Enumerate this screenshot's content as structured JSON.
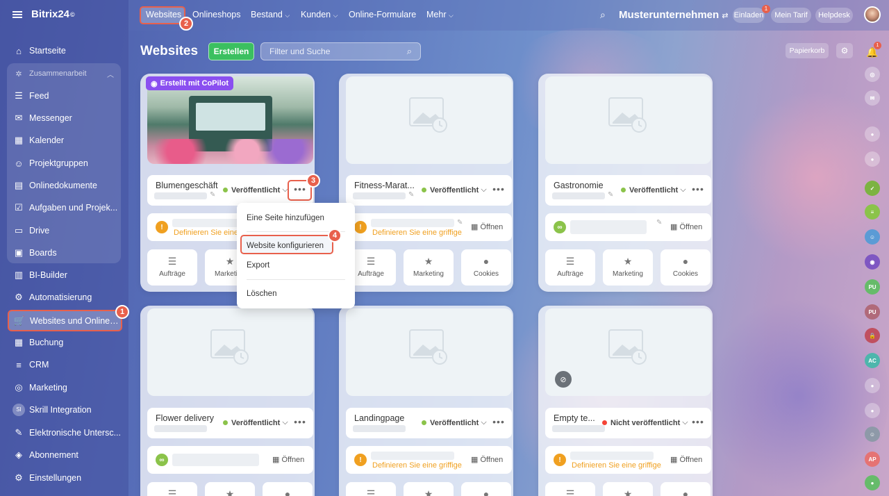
{
  "app": {
    "logo_text": "Bitrix24",
    "logo_mark": "©"
  },
  "sidebar": {
    "group_label": "Zusammenarbeit",
    "items": [
      {
        "label": "Startseite",
        "icon": "⌂"
      },
      {
        "label": "Feed",
        "icon": "☰"
      },
      {
        "label": "Messenger",
        "icon": "✉"
      },
      {
        "label": "Kalender",
        "icon": "▦"
      },
      {
        "label": "Projektgruppen",
        "icon": "☺"
      },
      {
        "label": "Onlinedokumente",
        "icon": "▤"
      },
      {
        "label": "Aufgaben und Projek...",
        "icon": "☑"
      },
      {
        "label": "Drive",
        "icon": "▭"
      },
      {
        "label": "Boards",
        "icon": "▣"
      },
      {
        "label": "BI-Builder",
        "icon": "▥"
      },
      {
        "label": "Automatisierung",
        "icon": "⚙"
      },
      {
        "label": "Websites und Onlines...",
        "icon": "🛒"
      },
      {
        "label": "Buchung",
        "icon": "▦"
      },
      {
        "label": "CRM",
        "icon": "≡"
      },
      {
        "label": "Marketing",
        "icon": "◎"
      },
      {
        "label": "Skrill Integration",
        "icon": "SI"
      },
      {
        "label": "Elektronische Untersc...",
        "icon": "✎"
      },
      {
        "label": "Abonnement",
        "icon": "◈"
      },
      {
        "label": "Einstellungen",
        "icon": "⚙"
      }
    ]
  },
  "topnav": {
    "items": [
      "Websites",
      "Onlineshops",
      "Bestand",
      "Kunden",
      "Online-Formulare",
      "Mehr"
    ],
    "company": "Musterunternehmen",
    "invite": "Einladen",
    "invite_badge": "1",
    "plan": "Mein Tarif",
    "help": "Helpdesk"
  },
  "page": {
    "title": "Websites",
    "create_label": "Erstellen",
    "search_placeholder": "Filter und Suche",
    "trash_label": "Papierkorb",
    "notif_badge": "1"
  },
  "common": {
    "open_label": "Öffnen",
    "define_hint": "Definieren Sie eine griffige...",
    "define_hint_short": "Definieren Sie eine",
    "tiles": [
      "Aufträge",
      "Marketing",
      "Cookies"
    ]
  },
  "sites": [
    {
      "name": "Blumengeschäft",
      "status": "Veröffentlicht",
      "badge": "Erstellt mit CoPilot"
    },
    {
      "name": "Fitness-Marat...",
      "status": "Veröffentlicht"
    },
    {
      "name": "Gastronomie",
      "status": "Veröffentlicht"
    },
    {
      "name": "Flower delivery",
      "status": "Veröffentlicht"
    },
    {
      "name": "Landingpage",
      "status": "Veröffentlicht"
    },
    {
      "name": "Empty te...",
      "status": "Nicht veröffentlicht"
    }
  ],
  "dropdown": {
    "items": [
      "Eine Seite hinzufügen",
      "Website konfigurieren",
      "Export",
      "Löschen"
    ]
  },
  "step_badges": [
    "1",
    "2",
    "3",
    "4"
  ],
  "colors": {
    "accent": "#e8604c",
    "green": "#3bc060",
    "published": "#8bc34a",
    "unpublished": "#f44336",
    "warning": "#f0a020",
    "copilot": "#8a4ff0"
  },
  "rightbar": {
    "initials": [
      "PU",
      "PU",
      "AC",
      "AP"
    ]
  }
}
